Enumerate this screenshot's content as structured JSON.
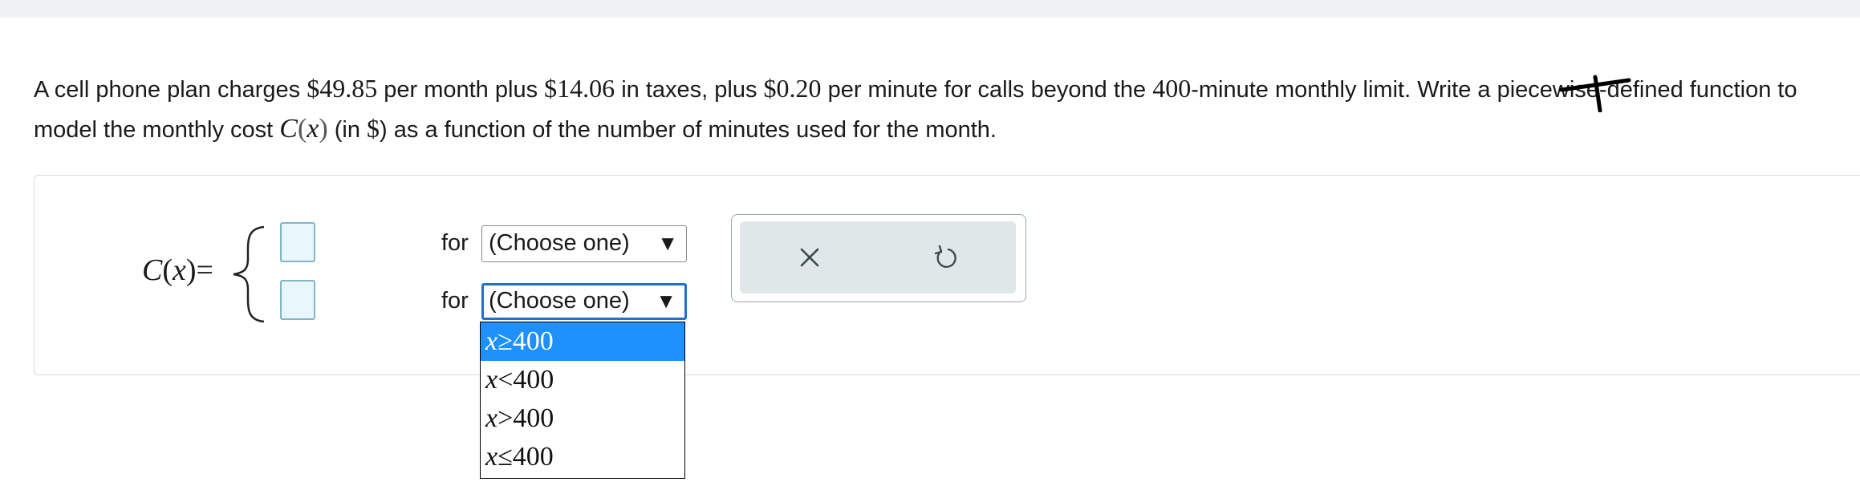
{
  "question": {
    "seg1": "A cell phone plan charges ",
    "price": "$49.85",
    "seg2": " per month plus ",
    "taxes": "$14.06",
    "seg3": " in taxes, plus ",
    "per_minute": "$0.20",
    "seg4": " per minute for calls beyond the ",
    "limit": "400",
    "seg5": "-minute monthly limit. Write a piecewise-defined function to model the monthly cost ",
    "func_name": "C",
    "func_var": "x",
    "seg6": " (in ",
    "unit": "$",
    "seg7": ") as a function of the number of minutes used for the month."
  },
  "answer": {
    "func_name": "C",
    "func_var": "x",
    "equals": "=",
    "for_label": "for",
    "select_placeholder": "(Choose one)",
    "select_arrow": "▼"
  },
  "tools": {
    "clear_icon": "close-icon",
    "undo_icon": "undo-icon"
  },
  "dropdown": {
    "options": [
      {
        "var": "x",
        "op": "≥",
        "num": "400",
        "selected": true
      },
      {
        "var": "x",
        "op": "<",
        "num": "400",
        "selected": false
      },
      {
        "var": "x",
        "op": ">",
        "num": "400",
        "selected": false
      },
      {
        "var": "x",
        "op": "≤",
        "num": "400",
        "selected": false
      }
    ]
  },
  "colors": {
    "highlight": "#1e90ff",
    "focus_border": "#1f6fd6",
    "answer_box_fill": "#e9f6fa",
    "tool_panel": "#dfe7e9"
  }
}
